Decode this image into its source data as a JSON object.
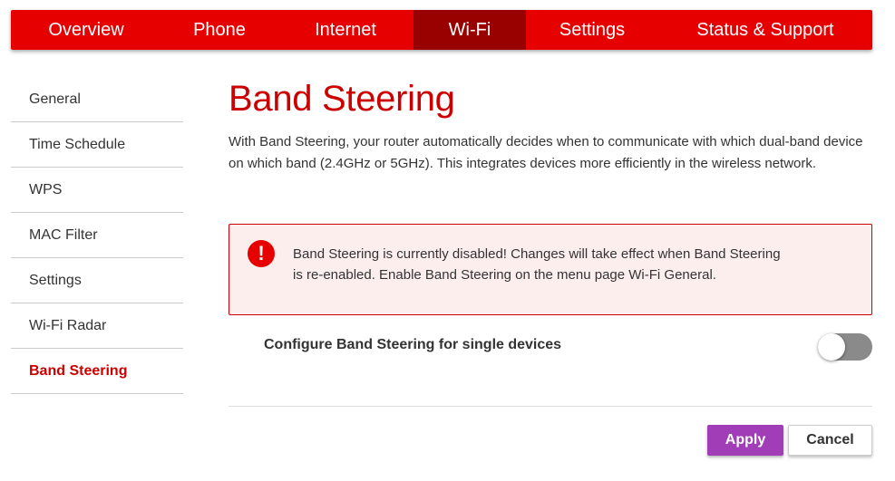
{
  "nav": {
    "tabs": [
      {
        "label": "Overview"
      },
      {
        "label": "Phone"
      },
      {
        "label": "Internet"
      },
      {
        "label": "Wi-Fi"
      },
      {
        "label": "Settings"
      },
      {
        "label": "Status & Support"
      }
    ],
    "active": "Wi-Fi"
  },
  "sidebar": {
    "items": [
      {
        "label": "General"
      },
      {
        "label": "Time Schedule"
      },
      {
        "label": "WPS"
      },
      {
        "label": "MAC Filter"
      },
      {
        "label": "Settings"
      },
      {
        "label": "Wi-Fi Radar"
      },
      {
        "label": "Band Steering"
      }
    ],
    "active": "Band Steering"
  },
  "main": {
    "title": "Band Steering",
    "intro": "With Band Steering, your router automatically decides when to communicate with which dual-band device on which band (2.4GHz or 5GHz). This integrates devices more efficiently in the wireless network.",
    "alert": {
      "icon": "exclamation-icon",
      "text": "Band Steering is currently disabled! Changes will take effect when Band Steering is re-enabled. Enable Band Steering on the menu page Wi-Fi General."
    },
    "setting": {
      "label": "Configure Band Steering for single devices",
      "enabled": false
    },
    "buttons": {
      "apply": "Apply",
      "cancel": "Cancel"
    }
  },
  "colors": {
    "brand_red": "#e60000",
    "active_tab": "#990000",
    "title_red": "#cc0000",
    "apply_purple": "#a23db8",
    "alert_bg": "#fdeeee"
  }
}
